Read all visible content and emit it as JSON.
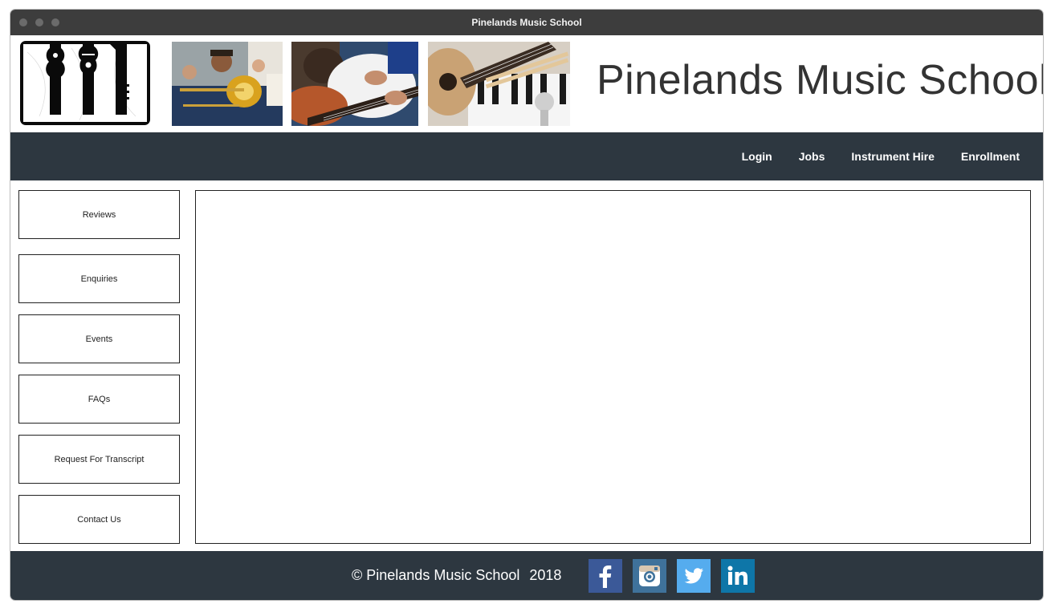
{
  "window": {
    "title": "Pinelands Music School"
  },
  "header": {
    "site_title": "Pinelands Music School",
    "logo_icon": "instruments-logo-icon",
    "photos": [
      "trombone-player-photo",
      "guitar-lesson-photo",
      "ukulele-piano-drumsticks-photo"
    ]
  },
  "nav": {
    "links": [
      "Login",
      "Jobs",
      "Instrument Hire",
      "Enrollment"
    ]
  },
  "sidebar": {
    "items": [
      "Reviews",
      "Enquiries",
      "Events",
      "FAQs",
      "Request For Transcript",
      "Contact Us"
    ]
  },
  "footer": {
    "copyright": "© Pinelands Music School",
    "year": "2018",
    "social": [
      "facebook-icon",
      "instagram-icon",
      "twitter-icon",
      "linkedin-icon"
    ]
  },
  "colors": {
    "titlebar": "#3d3d3d",
    "navbar": "#2d3740",
    "footer": "#2d3740",
    "facebook": "#3b5998",
    "instagram": "#3f729b",
    "twitter": "#55acee",
    "linkedin": "#0e76a8"
  }
}
